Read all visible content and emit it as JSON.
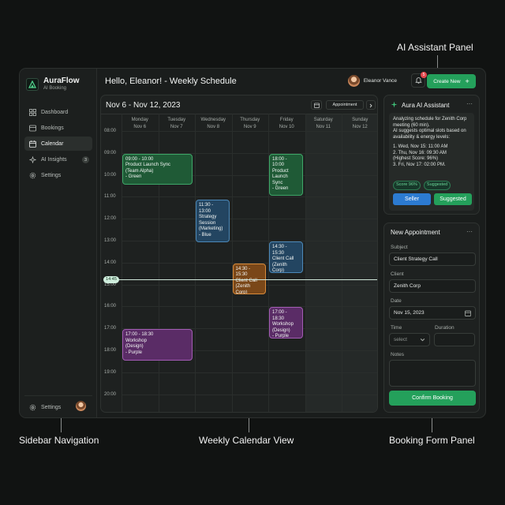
{
  "callouts": {
    "ai_panel": "AI Assistant Panel",
    "sidebar": "Sidebar Navigation",
    "calendar": "Weekly Calendar View",
    "booking": "Booking Form Panel"
  },
  "brand": {
    "name": "AuraFlow",
    "subtitle": "AI Booking"
  },
  "sidebar": {
    "items": [
      {
        "label": "Dashboard",
        "icon": "dashboard-icon"
      },
      {
        "label": "Bookings",
        "icon": "bookings-icon"
      },
      {
        "label": "Calendar",
        "icon": "calendar-icon",
        "active": true
      },
      {
        "label": "AI Insights",
        "icon": "sparkle-icon",
        "badge": "3"
      },
      {
        "label": "Settings",
        "icon": "gear-icon"
      }
    ],
    "bottom_label": "Settings"
  },
  "header": {
    "title": "Hello, Eleanor! - Weekly Schedule",
    "user_name": "Eleanor Vance",
    "notification_count": "5",
    "create_label": "Create New",
    "create_icon": "+"
  },
  "calendar": {
    "range": "Nov 6 - Nov 12, 2023",
    "view_label": "Appointment",
    "days": [
      {
        "name": "Monday",
        "date": "Nov 6"
      },
      {
        "name": "Tuesday",
        "date": "Nov 7"
      },
      {
        "name": "Wednesday",
        "date": "Nov 8"
      },
      {
        "name": "Thursday",
        "date": "Nov 9"
      },
      {
        "name": "Friday",
        "date": "Nov 10"
      },
      {
        "name": "Saturday",
        "date": "Nov 11"
      },
      {
        "name": "Sunday",
        "date": "Nov 12"
      }
    ],
    "hours": [
      "08:00",
      "09:00",
      "10:00",
      "11:00",
      "12:00",
      "13:00",
      "14:00",
      "15:00",
      "16:00",
      "17:00",
      "18:00",
      "19:00",
      "20:00"
    ],
    "now_label": "14:45",
    "now_hour": 14.75,
    "events": [
      {
        "day": 0,
        "span": 2,
        "start": 9.0,
        "end": 10.5,
        "color": "green",
        "lines": [
          "09:00 - 10:00",
          "Product Launch Sync",
          "(Team Alpha)",
          "- Green"
        ]
      },
      {
        "day": 4,
        "span": 1,
        "start": 9.0,
        "end": 11.0,
        "color": "green",
        "lines": [
          "18:00 - 10:00",
          "Product",
          "Launch Sync",
          "- Green"
        ]
      },
      {
        "day": 2,
        "span": 1,
        "start": 11.1,
        "end": 13.1,
        "color": "blue",
        "lines": [
          "11:30 - 13:00",
          "Strategy",
          "Session",
          "(Marketing)",
          "- Blue"
        ]
      },
      {
        "day": 4,
        "span": 1,
        "start": 13.0,
        "end": 14.5,
        "color": "blue",
        "lines": [
          "14:30 - 15:30",
          "Client Call",
          "(Zenith Corp)",
          "- Orange"
        ]
      },
      {
        "day": 3,
        "span": 1,
        "start": 14.0,
        "end": 15.5,
        "color": "orange",
        "lines": [
          "14:30 - 15:30",
          "Client Call",
          "(Zenith Corp)",
          "- Orange"
        ]
      },
      {
        "day": 4,
        "span": 1,
        "start": 16.0,
        "end": 17.5,
        "color": "purple",
        "lines": [
          "17:00 - 18:30",
          "Workshop",
          "(Design)",
          "- Purple"
        ]
      },
      {
        "day": 0,
        "span": 2,
        "start": 17.0,
        "end": 18.5,
        "color": "purple",
        "lines": [
          "17:00 - 18:30",
          "Workshop",
          "(Design)",
          "- Purple"
        ]
      }
    ]
  },
  "ai_panel": {
    "title": "Aura AI Assistant",
    "intro": "Analyzing schedule for Zenith Corp meeting (60 min).",
    "subtitle": "AI suggests optimal slots based on availability & energy levels:",
    "suggestions": [
      "1. Wed, Nov 15: 11:00 AM",
      "2. Thu, Nov 16: 09:30 AM",
      "(Highest Score: 96%)",
      "3. Fri, Nov 17: 02:00 PM."
    ],
    "tags": [
      "Score 96%",
      "Suggested"
    ],
    "btn_secondary": "Seller",
    "btn_primary": "Suggested"
  },
  "form": {
    "title": "New Appointment",
    "subject_label": "Subject",
    "subject_value": "Client Strategy Call",
    "client_label": "Client",
    "client_value": "Zenith Corp",
    "date_label": "Date",
    "date_value": "Nov 15, 2023",
    "time_label": "Time",
    "time_placeholder": "select",
    "duration_label": "Duration",
    "notes_label": "Notes",
    "confirm_label": "Confirm Booking"
  },
  "colors": {
    "accent_green": "#24a05b",
    "accent_blue": "#2c7bd1",
    "event_green": "#1f5a36",
    "event_blue": "#234561",
    "event_orange": "#7a4718",
    "event_purple": "#5a2c66"
  }
}
